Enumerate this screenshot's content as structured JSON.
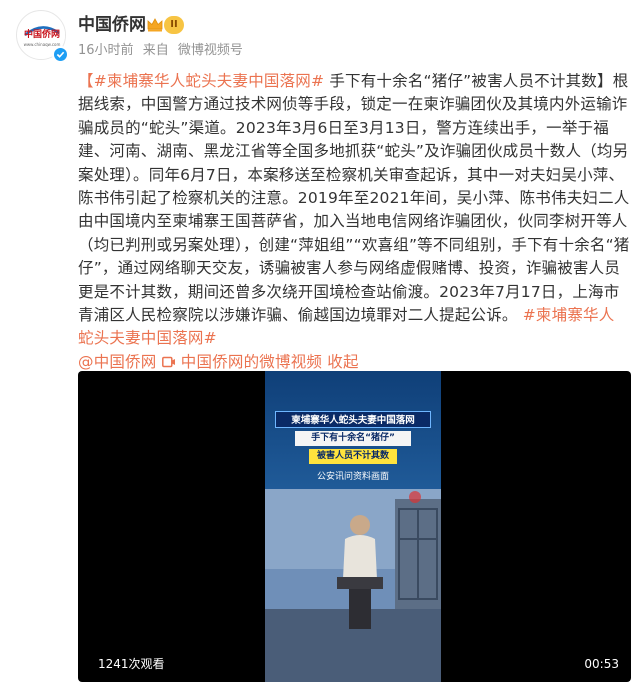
{
  "author": {
    "name": "中国侨网",
    "level": "II",
    "logo_text": "中国侨网",
    "logo_url_text": "www.chinaqw.com"
  },
  "meta": {
    "time": "16小时前",
    "source_prefix": "来自",
    "source": "微博视频号"
  },
  "post": {
    "hashtag_open": "【#柬埔寨华人蛇头夫妻中国落网#",
    "headline_rest": " 手下有十余名“猪仔”被害人员不计其数】",
    "body": "根据线索，中国警方通过技术网侦等手段，锁定一在柬诈骗团伙及其境内外运输诈骗成员的“蛇头”渠道。2023年3月6日至3月13日，警方连续出手，一举于福建、河南、湖南、黑龙江省等全国多地抓获“蛇头”及诈骗团伙成员十数人（均另案处理）。同年6月7日，本案移送至检察机关审查起诉，其中一对夫妇吴小萍、陈书伟引起了检察机关的注意。2019年至2021年间，吴小萍、陈书伟夫妇二人由中国境内至柬埔寨王国菩萨省，加入当地电信网络诈骗团伙，伙同李树开等人（均已判刑或另案处理），创建“萍姐组”“欢喜组”等不同组别，手下有十余名“猪仔”，通过网络聊天交友，诱骗被害人参与网络虚假赌博、投资，诈骗被害人员更是不计其数，期间还曾多次绕开国境检查站偷渡。2023年7月17日，上海市青浦区人民检察院以涉嫌诈骗、偷越国边境罪对二人提起公诉。",
    "hashtag_end": "#柬埔寨华人蛇头夫妻中国落网#",
    "mention": "@中国侨网",
    "video_link": "中国侨网的微博视频",
    "collapse": "收起"
  },
  "video": {
    "caption_line1": "柬埔寨华人蛇头夫妻中国落网",
    "caption_line2": "手下有十余名“猪仔”",
    "caption_line3": "被害人员不计其数",
    "frame_label": "公安讯问资料画面",
    "play_count": "1241次观看",
    "duration": "00:53"
  },
  "colors": {
    "link": "#eb7350",
    "blue_link": "#1e6fbf",
    "verified": "#1e9ef4"
  }
}
